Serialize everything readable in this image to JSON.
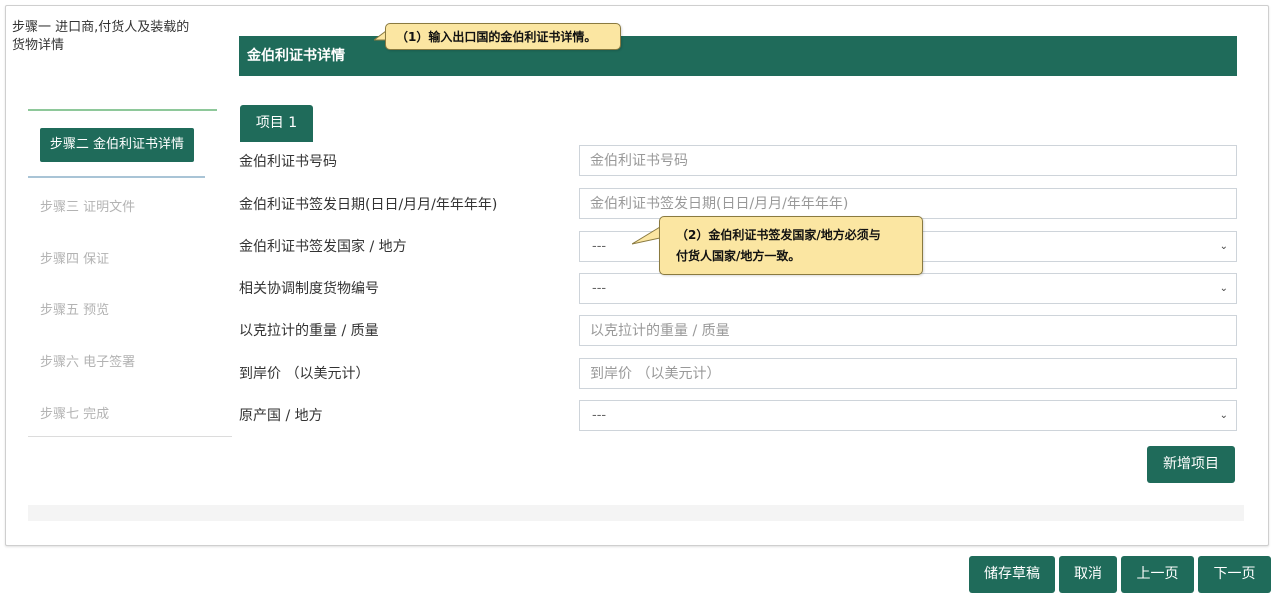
{
  "sidebar": {
    "step1": "步骤一 进口商,付货人及装载的货物详情",
    "step2": "步骤二 金伯利证书详情",
    "step3": "步骤三 证明文件",
    "step4": "步骤四 保证",
    "step5": "步骤五 预览",
    "step6": "步骤六 电子签署",
    "step7": "步骤七 完成"
  },
  "section": {
    "title": "金伯利证书详情",
    "item_tab": "项目 1"
  },
  "form": {
    "cert_no": {
      "label": "金伯利证书号码",
      "placeholder": "金伯利证书号码",
      "value": ""
    },
    "issue_date": {
      "label": "金伯利证书签发日期(日日/月月/年年年年)",
      "placeholder": "金伯利证书签发日期(日日/月月/年年年年)",
      "value": ""
    },
    "issue_country": {
      "label": "金伯利证书签发国家 / 地方",
      "selected": "---"
    },
    "hs_code": {
      "label": "相关协调制度货物编号",
      "selected": "---"
    },
    "weight": {
      "label": "以克拉计的重量 / 质量",
      "placeholder": "以克拉计的重量 / 质量",
      "value": ""
    },
    "cif": {
      "label": "到岸价 （以美元计）",
      "placeholder": "到岸价 （以美元计）",
      "value": ""
    },
    "origin": {
      "label": "原产国 / 地方",
      "selected": "---"
    }
  },
  "buttons": {
    "add_item": "新增项目",
    "save_draft": "储存草稿",
    "cancel": "取消",
    "prev": "上一页",
    "next": "下一页"
  },
  "callouts": {
    "c1": "（1）输入出口国的金伯利证书详情。",
    "c2_line1": "（2）金伯利证书签发国家/地方必须与",
    "c2_line2": "付货人国家/地方一致。"
  },
  "colors": {
    "primary": "#1f6b5a",
    "callout_bg": "#fbe6a2"
  }
}
